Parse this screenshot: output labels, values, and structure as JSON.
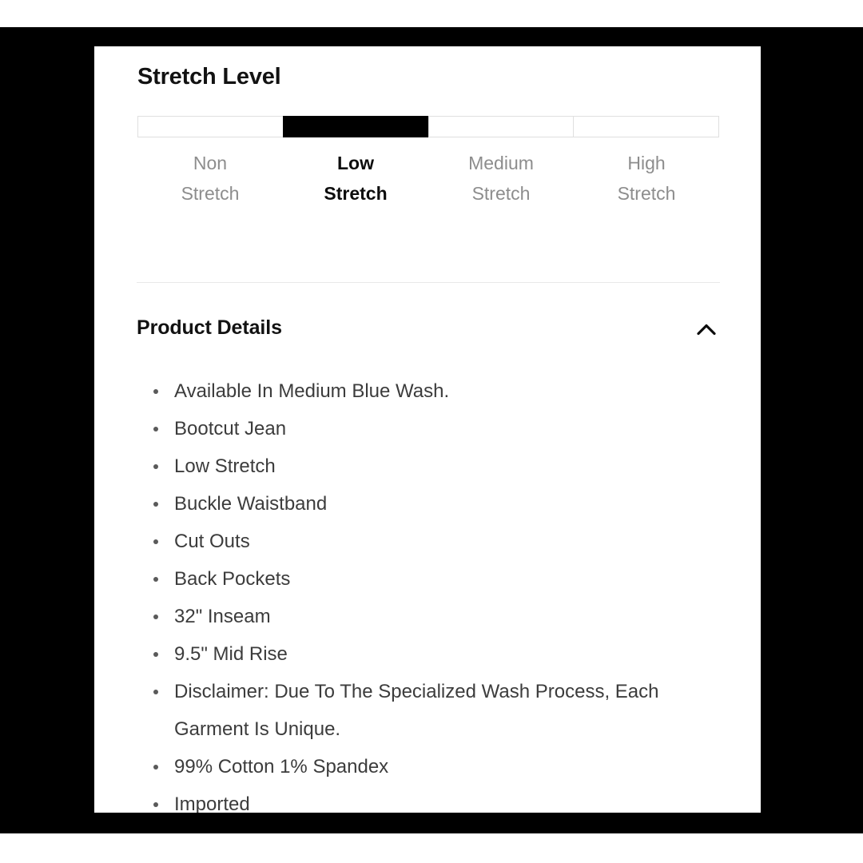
{
  "card": {
    "stretch": {
      "title": "Stretch Level",
      "levels": [
        {
          "line1": "Non",
          "line2": "Stretch",
          "active": false
        },
        {
          "line1": "Low",
          "line2": "Stretch",
          "active": true
        },
        {
          "line1": "Medium",
          "line2": "Stretch",
          "active": false
        },
        {
          "line1": "High",
          "line2": "Stretch",
          "active": false
        }
      ],
      "selected_index": 1,
      "selected_label": "Low Stretch"
    },
    "details": {
      "title": "Product Details",
      "toggle_icon": "chevron-up-icon",
      "expanded": true,
      "items": [
        "Available In Medium Blue Wash.",
        "Bootcut Jean",
        "Low Stretch",
        "Buckle Waistband",
        "Cut Outs",
        "Back Pockets",
        "32\" Inseam",
        "9.5\" Mid Rise",
        "Disclaimer: Due To The Specialized Wash Process, Each Garment Is Unique.",
        "99% Cotton 1% Spandex",
        "Imported"
      ]
    }
  },
  "colors": {
    "active_segment": "#000000",
    "inactive_segment": "#ffffff",
    "segment_border": "#dfdfdf",
    "inactive_label": "#8d8d8d",
    "active_label": "#0d0d0d",
    "body_text": "#3c3c3c",
    "heading": "#121212",
    "divider": "#e9e9e9",
    "scrollbar_thumb": "#8c8c8c",
    "page_background": "#000000",
    "card_background": "#ffffff"
  }
}
